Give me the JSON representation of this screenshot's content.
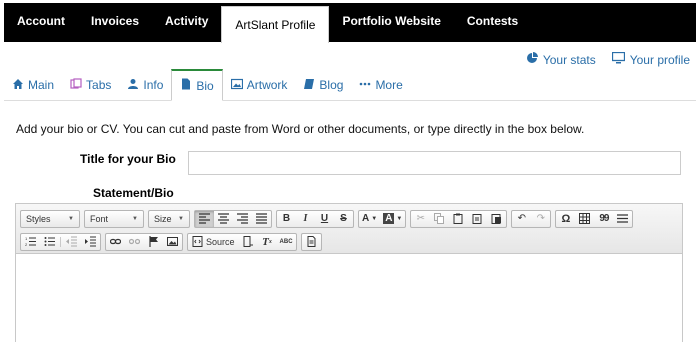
{
  "topnav": {
    "items": [
      {
        "label": "Account"
      },
      {
        "label": "Invoices"
      },
      {
        "label": "Activity"
      },
      {
        "label": "ArtSlant Profile",
        "active": true
      },
      {
        "label": "Portfolio Website"
      },
      {
        "label": "Contests"
      }
    ]
  },
  "stats": {
    "your_stats": "Your stats",
    "your_profile": "Your profile"
  },
  "subtabs": {
    "items": [
      {
        "label": "Main",
        "icon": "home-icon"
      },
      {
        "label": "Tabs",
        "icon": "tabs-icon"
      },
      {
        "label": "Info",
        "icon": "user-icon"
      },
      {
        "label": "Bio",
        "icon": "file-icon",
        "active": true
      },
      {
        "label": "Artwork",
        "icon": "image-icon"
      },
      {
        "label": "Blog",
        "icon": "book-icon"
      },
      {
        "label": "More",
        "icon": "ellipsis-icon"
      }
    ]
  },
  "intro": "Add your bio or CV. You can cut and paste from Word or other documents, or type directly in the box below.",
  "form": {
    "title_label": "Title for your Bio",
    "title_value": "",
    "statement_label": "Statement/Bio"
  },
  "editor": {
    "styles": "Styles",
    "font": "Font",
    "size": "Size",
    "bold": "B",
    "italic": "I",
    "underline": "U",
    "strike": "S",
    "textcolor": "A",
    "bgcolor": "A",
    "omega": "Ω",
    "quote": "99",
    "source": "Source",
    "clearformat": "Tx",
    "spell": "ABC"
  },
  "colors": {
    "link": "#2a6ea8",
    "active_tab_border": "#2a8a3a",
    "nav_bg": "#000000"
  }
}
